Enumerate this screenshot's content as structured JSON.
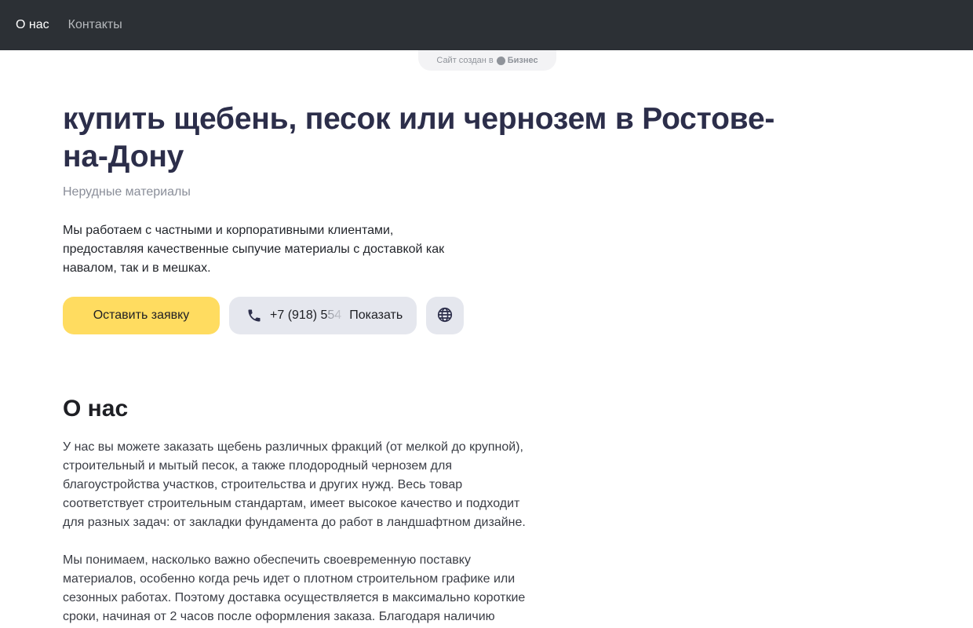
{
  "nav": {
    "items": [
      {
        "label": "О нас"
      },
      {
        "label": "Контакты"
      }
    ]
  },
  "badge": {
    "text": "Сайт создан в",
    "brand": "Бизнес"
  },
  "hero": {
    "title": "купить щебень, песок или чернозем в Ростове-на-Дону",
    "subtitle": "Нерудные материалы",
    "description": "Мы работаем с частными и корпоративными клиентами, предоставляя качественные сыпучие материалы с доставкой как навалом, так и в мешках.",
    "cta_label": "Оставить заявку",
    "phone_prefix": "+7 (918) 5",
    "phone_fade": "54",
    "phone_show_label": "Показать"
  },
  "about": {
    "title": "О нас",
    "paragraph1": "У нас вы можете заказать щебень различных фракций (от мелкой до крупной), строительный и мытый песок, а также плодородный чернозем для благоустройства участков, строительства и других нужд. Весь товар соответствует строительным стандартам, имеет высокое качество и подходит для разных задач: от закладки фундамента до работ в ландшафтном дизайне.",
    "paragraph2": "Мы понимаем, насколько важно обеспечить своевременную поставку материалов, особенно когда речь идет о плотном строительном графике или сезонных работах. Поэтому доставка осуществляется в максимально короткие сроки, начиная от 2 часов после оформления заказа. Благодаря наличию"
  },
  "colors": {
    "topbar": "#2c3035",
    "cta": "#ffdc60",
    "secondary_button": "#e5e7ee",
    "title": "#2c2e4a"
  },
  "icons": {
    "phone": "phone-icon",
    "globe": "globe-icon",
    "brand": "yandex-business-logo-icon"
  }
}
